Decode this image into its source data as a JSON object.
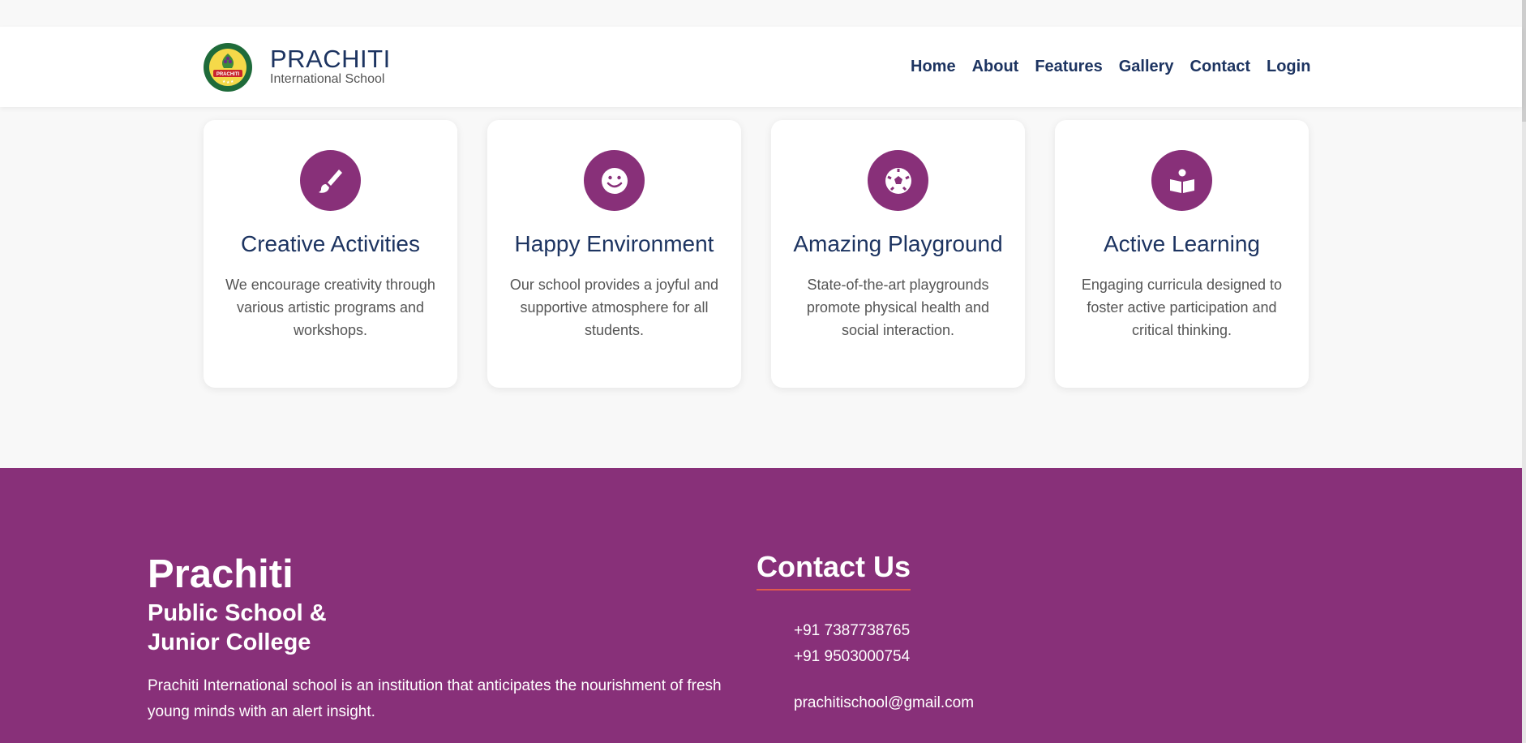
{
  "header": {
    "brand_title": "PRACHITI",
    "brand_subtitle": "International School",
    "logo": {
      "ring_text": "INTERNATIONAL SCHOOL",
      "banner_text": "PRACHITI",
      "motto": "विनयः सत्य सर्व सिद्धिः"
    },
    "nav": [
      {
        "label": "Home"
      },
      {
        "label": "About"
      },
      {
        "label": "Features"
      },
      {
        "label": "Gallery"
      },
      {
        "label": "Contact"
      },
      {
        "label": "Login"
      }
    ]
  },
  "features": [
    {
      "icon": "paintbrush-icon",
      "title": "Creative Activities",
      "description": "We encourage creativity through various artistic programs and workshops."
    },
    {
      "icon": "smile-icon",
      "title": "Happy Environment",
      "description": "Our school provides a joyful and supportive atmosphere for all students."
    },
    {
      "icon": "football-icon",
      "title": "Amazing Playground",
      "description": "State-of-the-art playgrounds promote physical health and social interaction."
    },
    {
      "icon": "book-reader-icon",
      "title": "Active Learning",
      "description": "Engaging curricula designed to foster active participation and critical thinking."
    }
  ],
  "footer": {
    "school_name": "Prachiti",
    "school_tagline_line1": "Public School &",
    "school_tagline_line2": "Junior College",
    "description": "Prachiti International school is an institution that anticipates the nourishment of fresh young minds with an alert insight.",
    "contact_heading": "Contact Us",
    "phones": [
      "+91 7387738765",
      "+91 9503000754"
    ],
    "email": "prachitischool@gmail.com"
  },
  "colors": {
    "brand_purple": "#883079",
    "navy_text": "#1d3461",
    "accent_underline": "#e05a4e",
    "page_background": "#f8f8f8"
  }
}
